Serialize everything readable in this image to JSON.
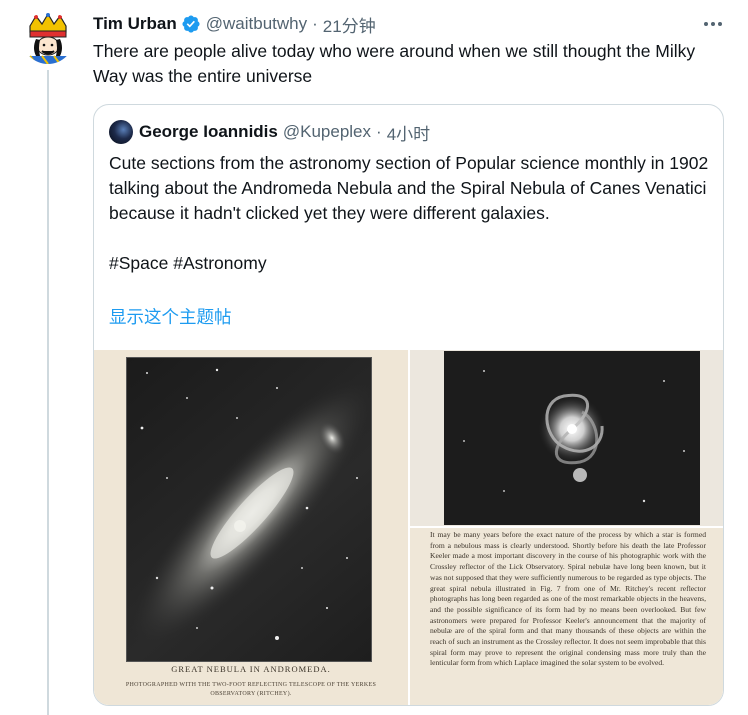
{
  "tweet": {
    "author_name": "Tim Urban",
    "handle": "@waitbutwhy",
    "separator": "·",
    "time": "21分钟",
    "text": "There are people alive today who were around when we still thought the Milky Way was the entire universe"
  },
  "quoted_tweet": {
    "author_name": "George Ioannidis",
    "handle": "@Kupeplex",
    "separator": "·",
    "time": "4小时",
    "text": "Cute sections from the astronomy section of Popular science monthly in 1902 talking about the Andromeda Nebula and the Spiral Nebula of Canes Venatici because it hadn't clicked yet they were different galaxies.\n\n#Space #Astronomy",
    "show_thread_label": "显示这个主题帖",
    "media": {
      "caption_title": "GREAT NEBULA IN ANDROMEDA.",
      "caption_subtitle": "PHOTOGRAPHED WITH THE TWO-FOOT REFLECTING TELESCOPE OF THE YERKES OBSERVATORY (RITCHEY).",
      "page_text": "It may be many years before the exact nature of the process by which a star is formed from a nebulous mass is clearly understood. Shortly before his death the late Professor Keeler made a most important discovery in the course of his photographic work with the Crossley reflector of the Lick Observatory. Spiral nebulæ have long been known, but it was not supposed that they were sufficiently numerous to be regarded as type objects. The great spiral nebula illustrated in Fig. 7 from one of Mr. Ritchey's recent reflector photographs has long been regarded as one of the most remarkable objects in the heavens, and the possible significance of its form had by no means been overlooked. But few astronomers were prepared for Professor Keeler's announcement that the majority of nebulæ are of the spiral form and that many thousands of these objects are within the reach of such an instrument as the Crossley reflector. It does not seem improbable that this spiral form may prove to represent the original condensing mass more truly than the lenticular form from which Laplace imagined the solar system to be evolved."
    }
  },
  "colors": {
    "link": "#1d9bf0",
    "verified": "#1d9bf0",
    "secondary_text": "#536471",
    "border": "#cfd9de"
  },
  "icons": {
    "verified": "verified-badge-icon",
    "more": "more-dots-icon"
  }
}
